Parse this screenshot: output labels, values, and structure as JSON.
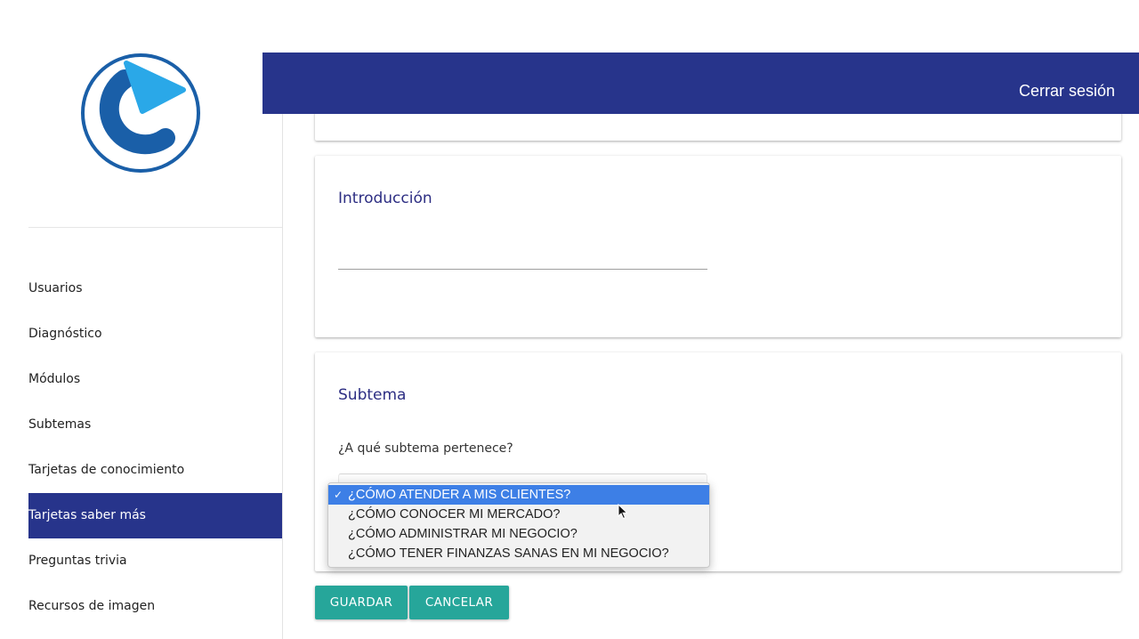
{
  "header": {
    "logout_label": "Cerrar sesión"
  },
  "brand": {
    "logo_icon": "play-logo-icon",
    "colors": {
      "primary_dark": "#1a5fa8",
      "primary_light": "#2aa8e8"
    }
  },
  "sidebar": {
    "items": [
      {
        "label": "Usuarios",
        "active": false
      },
      {
        "label": "Diagnóstico",
        "active": false
      },
      {
        "label": "Módulos",
        "active": false
      },
      {
        "label": "Subtemas",
        "active": false
      },
      {
        "label": "Tarjetas de conocimiento",
        "active": false
      },
      {
        "label": "Tarjetas saber más",
        "active": true
      },
      {
        "label": "Preguntas trivia",
        "active": false
      },
      {
        "label": "Recursos de imagen",
        "active": false
      }
    ]
  },
  "form": {
    "intro": {
      "title": "Introducción",
      "value": ""
    },
    "subtema": {
      "title": "Subtema",
      "question": "¿A qué subtema pertenece?",
      "options": [
        {
          "label": "¿CÓMO ATENDER A MIS CLIENTES?",
          "selected": true
        },
        {
          "label": "¿CÓMO CONOCER MI MERCADO?",
          "selected": false
        },
        {
          "label": "¿CÓMO ADMINISTRAR MI NEGOCIO?",
          "selected": false
        },
        {
          "label": "¿CÓMO TENER FINANZAS SANAS EN MI NEGOCIO?",
          "selected": false
        }
      ],
      "check_glyph": "✓"
    }
  },
  "actions": {
    "save_label": "GUARDAR",
    "cancel_label": "CANCELAR"
  },
  "colors": {
    "header_bg": "#27348b",
    "active_nav_bg": "#27348b",
    "button_bg": "#26a69a",
    "title_color": "#2d2e83",
    "selected_option_bg": "#3d7fe6"
  }
}
